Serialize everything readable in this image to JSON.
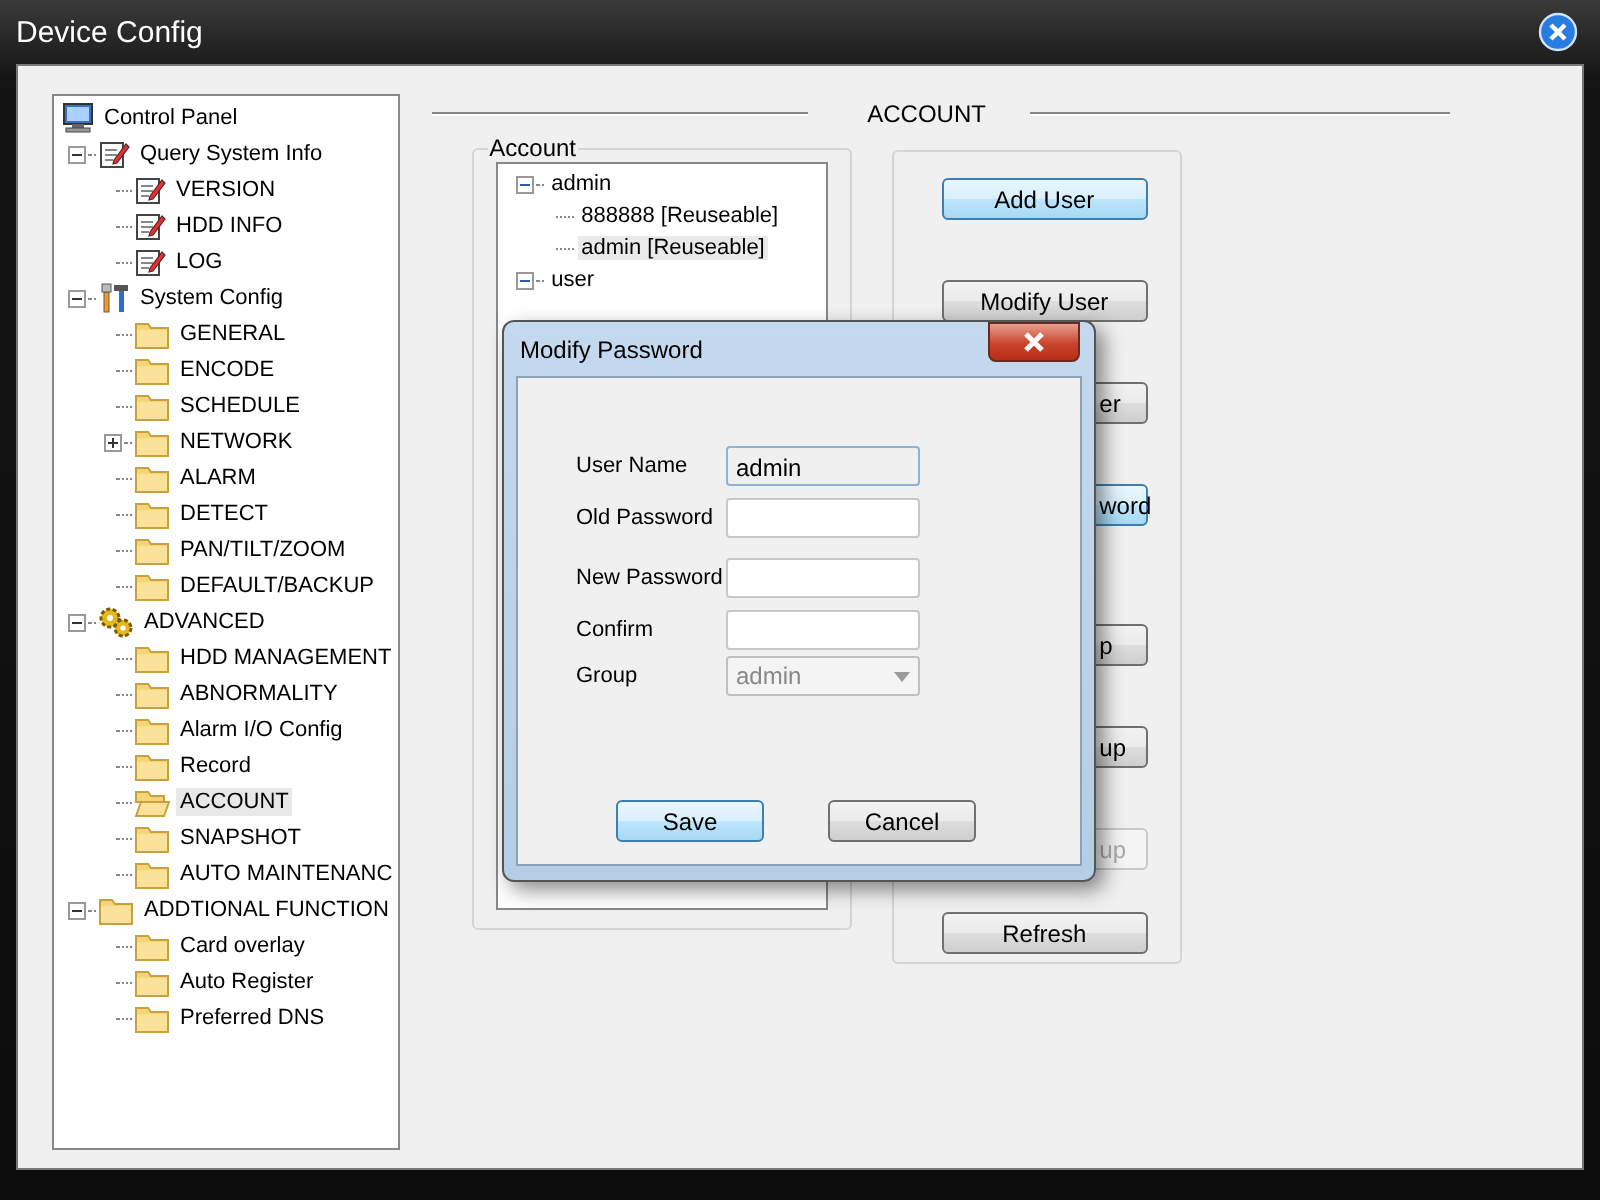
{
  "window": {
    "title": "Device Config"
  },
  "sidebar": {
    "tree": [
      {
        "label": "Control Panel",
        "kind": "computer",
        "selected": false,
        "children": [
          {
            "label": "Query System Info",
            "kind": "document",
            "selected": false,
            "expanded": true,
            "children": [
              {
                "label": "VERSION",
                "kind": "document",
                "selected": false
              },
              {
                "label": "HDD INFO",
                "kind": "document",
                "selected": false
              },
              {
                "label": "LOG",
                "kind": "document",
                "selected": false
              }
            ]
          },
          {
            "label": "System Config",
            "kind": "tools",
            "selected": false,
            "expanded": true,
            "children": [
              {
                "label": "GENERAL",
                "kind": "folder",
                "selected": false
              },
              {
                "label": "ENCODE",
                "kind": "folder",
                "selected": false
              },
              {
                "label": "SCHEDULE",
                "kind": "folder",
                "selected": false
              },
              {
                "label": "NETWORK",
                "kind": "folder",
                "selected": false,
                "expanded": false
              },
              {
                "label": "ALARM",
                "kind": "folder",
                "selected": false
              },
              {
                "label": "DETECT",
                "kind": "folder",
                "selected": false
              },
              {
                "label": "PAN/TILT/ZOOM",
                "kind": "folder",
                "selected": false
              },
              {
                "label": "DEFAULT/BACKUP",
                "kind": "folder",
                "selected": false
              }
            ]
          },
          {
            "label": "ADVANCED",
            "kind": "gears",
            "selected": false,
            "expanded": true,
            "children": [
              {
                "label": "HDD MANAGEMENT",
                "kind": "folder",
                "selected": false
              },
              {
                "label": "ABNORMALITY",
                "kind": "folder",
                "selected": false
              },
              {
                "label": "Alarm I/O Config",
                "kind": "folder",
                "selected": false
              },
              {
                "label": "Record",
                "kind": "folder",
                "selected": false
              },
              {
                "label": "ACCOUNT",
                "kind": "folder",
                "selected": true
              },
              {
                "label": "SNAPSHOT",
                "kind": "folder",
                "selected": false
              },
              {
                "label": "AUTO MAINTENANC",
                "kind": "folder",
                "selected": false
              }
            ]
          },
          {
            "label": "ADDTIONAL FUNCTION",
            "kind": "folder",
            "selected": false,
            "expanded": true,
            "children": [
              {
                "label": "Card overlay",
                "kind": "folder",
                "selected": false
              },
              {
                "label": "Auto Register",
                "kind": "folder",
                "selected": false
              },
              {
                "label": "Preferred DNS",
                "kind": "folder",
                "selected": false
              }
            ]
          }
        ]
      }
    ]
  },
  "section_title": "ACCOUNT",
  "account_group": {
    "label": "Account",
    "tree": [
      {
        "label": "admin",
        "selected": false,
        "expanded": true,
        "children": [
          {
            "label": "888888 [Reuseable]",
            "selected": false
          },
          {
            "label": "admin [Reuseable]",
            "selected": true
          }
        ]
      },
      {
        "label": "user",
        "selected": false,
        "expanded": true
      }
    ]
  },
  "buttons": [
    {
      "label": "Add User",
      "kind": "full",
      "focused": true,
      "disabled": false
    },
    {
      "label": "Modify User",
      "kind": "full",
      "focused": false,
      "disabled": false
    },
    {
      "label": "er",
      "kind": "covered",
      "focused": false,
      "disabled": false
    },
    {
      "label": "word",
      "kind": "covered",
      "focused": true,
      "disabled": false
    },
    {
      "label": "p",
      "kind": "covered",
      "focused": false,
      "disabled": false
    },
    {
      "label": "up",
      "kind": "covered",
      "focused": false,
      "disabled": false
    },
    {
      "label": "up",
      "kind": "covered",
      "focused": false,
      "disabled": true
    },
    {
      "label": "Refresh",
      "kind": "full",
      "focused": false,
      "disabled": false
    }
  ],
  "dialog": {
    "title": "Modify Password",
    "fields": [
      {
        "label": "User Name",
        "kind": "text",
        "value": "admin",
        "disabled": true
      },
      {
        "label": "Old Password",
        "kind": "text",
        "disabled": false
      },
      {
        "label": "New Password",
        "kind": "text",
        "disabled": false
      },
      {
        "label": "Confirm",
        "kind": "text",
        "disabled": false
      },
      {
        "label": "Group",
        "kind": "select",
        "value": "admin",
        "disabled": true
      }
    ],
    "buttons": [
      {
        "label": "Save",
        "focused": true
      },
      {
        "label": "Cancel",
        "focused": false
      }
    ]
  }
}
